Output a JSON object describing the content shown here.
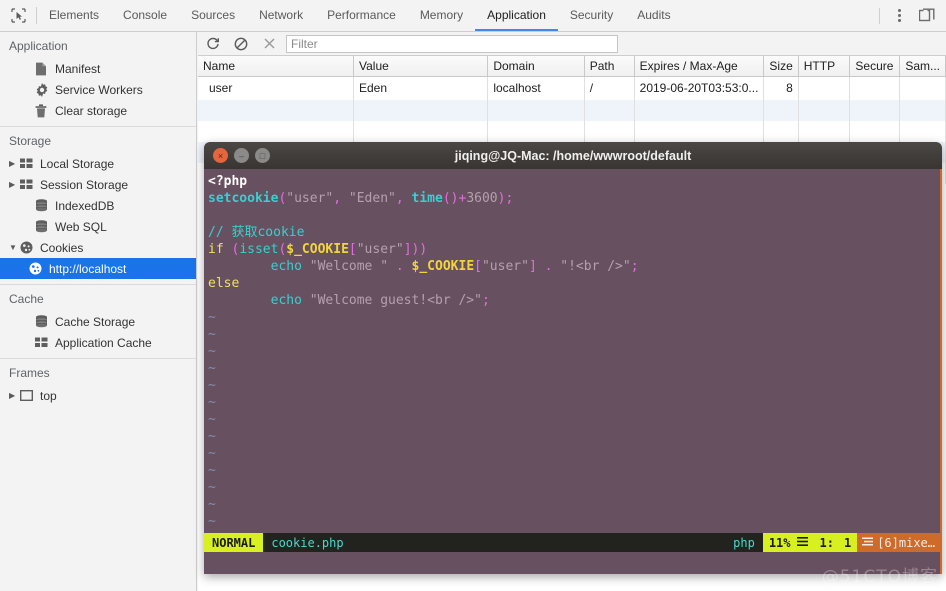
{
  "devtools": {
    "inspect_icon": "inspect-cursor-icon",
    "tabs": [
      {
        "label": "Elements",
        "active": false
      },
      {
        "label": "Console",
        "active": false
      },
      {
        "label": "Sources",
        "active": false
      },
      {
        "label": "Network",
        "active": false
      },
      {
        "label": "Performance",
        "active": false
      },
      {
        "label": "Memory",
        "active": false
      },
      {
        "label": "Application",
        "active": true
      },
      {
        "label": "Security",
        "active": false
      },
      {
        "label": "Audits",
        "active": false
      }
    ],
    "right_icons": [
      {
        "name": "more-options-icon",
        "glyph": "kebab"
      },
      {
        "name": "dock-position-icon",
        "glyph": "dock"
      }
    ],
    "accent_color": "#4285f4"
  },
  "subbar": {
    "refresh_icon": "refresh-icon",
    "clear_icon": "clear-icon",
    "close_icon": "close-icon",
    "filter_placeholder": "Filter",
    "filter_value": ""
  },
  "sidebar": {
    "sections": [
      {
        "title": "Application",
        "items": [
          {
            "label": "Manifest",
            "icon": "document-icon",
            "arrow": "",
            "selected": false,
            "indent": 0
          },
          {
            "label": "Service Workers",
            "icon": "gear-icon",
            "arrow": "",
            "selected": false,
            "indent": 0
          },
          {
            "label": "Clear storage",
            "icon": "trash-icon",
            "arrow": "",
            "selected": false,
            "indent": 0
          }
        ]
      },
      {
        "title": "Storage",
        "items": [
          {
            "label": "Local Storage",
            "icon": "table-icon",
            "arrow": "▶",
            "selected": false,
            "indent": 0
          },
          {
            "label": "Session Storage",
            "icon": "table-icon",
            "arrow": "▶",
            "selected": false,
            "indent": 0
          },
          {
            "label": "IndexedDB",
            "icon": "database-icon",
            "arrow": "",
            "selected": false,
            "indent": 0
          },
          {
            "label": "Web SQL",
            "icon": "database-icon",
            "arrow": "",
            "selected": false,
            "indent": 0
          },
          {
            "label": "Cookies",
            "icon": "cookie-icon",
            "arrow": "▼",
            "selected": false,
            "indent": 0
          },
          {
            "label": "http://localhost",
            "icon": "cookie-icon",
            "arrow": "",
            "selected": true,
            "indent": 1
          }
        ]
      },
      {
        "title": "Cache",
        "items": [
          {
            "label": "Cache Storage",
            "icon": "database-icon",
            "arrow": "",
            "selected": false,
            "indent": 0
          },
          {
            "label": "Application Cache",
            "icon": "table-icon",
            "arrow": "",
            "selected": false,
            "indent": 0
          }
        ]
      },
      {
        "title": "Frames",
        "items": [
          {
            "label": "top",
            "icon": "frame-icon",
            "arrow": "▶",
            "selected": false,
            "indent": 0
          }
        ]
      }
    ],
    "selection_color": "#1a73e8"
  },
  "cookie_table": {
    "columns": [
      "Name",
      "Value",
      "Domain",
      "Path",
      "Expires / Max-Age",
      "Size",
      "HTTP",
      "Secure",
      "Sam..."
    ],
    "rows": [
      {
        "Name": "user",
        "Value": "Eden",
        "Domain": "localhost",
        "Path": "/",
        "Expires / Max-Age": "2019-06-20T03:53:0...",
        "Size": "8",
        "HTTP": "",
        "Secure": "",
        "Sam...": ""
      }
    ]
  },
  "terminal": {
    "title": "jiqing@JQ-Mac: /home/wwwroot/default",
    "buttons": [
      {
        "name": "close-window-button",
        "glyph": "×"
      },
      {
        "name": "minimize-window-button",
        "glyph": "–"
      },
      {
        "name": "maximize-window-button",
        "glyph": "□"
      }
    ],
    "code_lines": [
      "<?php",
      "setcookie(\"user\", \"Eden\", time()+3600);",
      "",
      "// 获取cookie",
      "if (isset($_COOKIE[\"user\"]))",
      "        echo \"Welcome \" . $_COOKIE[\"user\"] . \"!<br />\";",
      "else",
      "        echo \"Welcome guest!<br />\";"
    ],
    "empty_line_marker": "~",
    "empty_line_count": 14,
    "statusline": {
      "mode": "NORMAL",
      "filename": "cookie.php",
      "filetype": "php",
      "percent": "11%",
      "line_col_label": "1:",
      "col": "1",
      "warning": "[6]mixe…"
    },
    "background_color": "#67505f",
    "titlebar_color": "#3e3b38",
    "accent_color": "#cf6b2a"
  },
  "watermark": "@51CTO博客"
}
